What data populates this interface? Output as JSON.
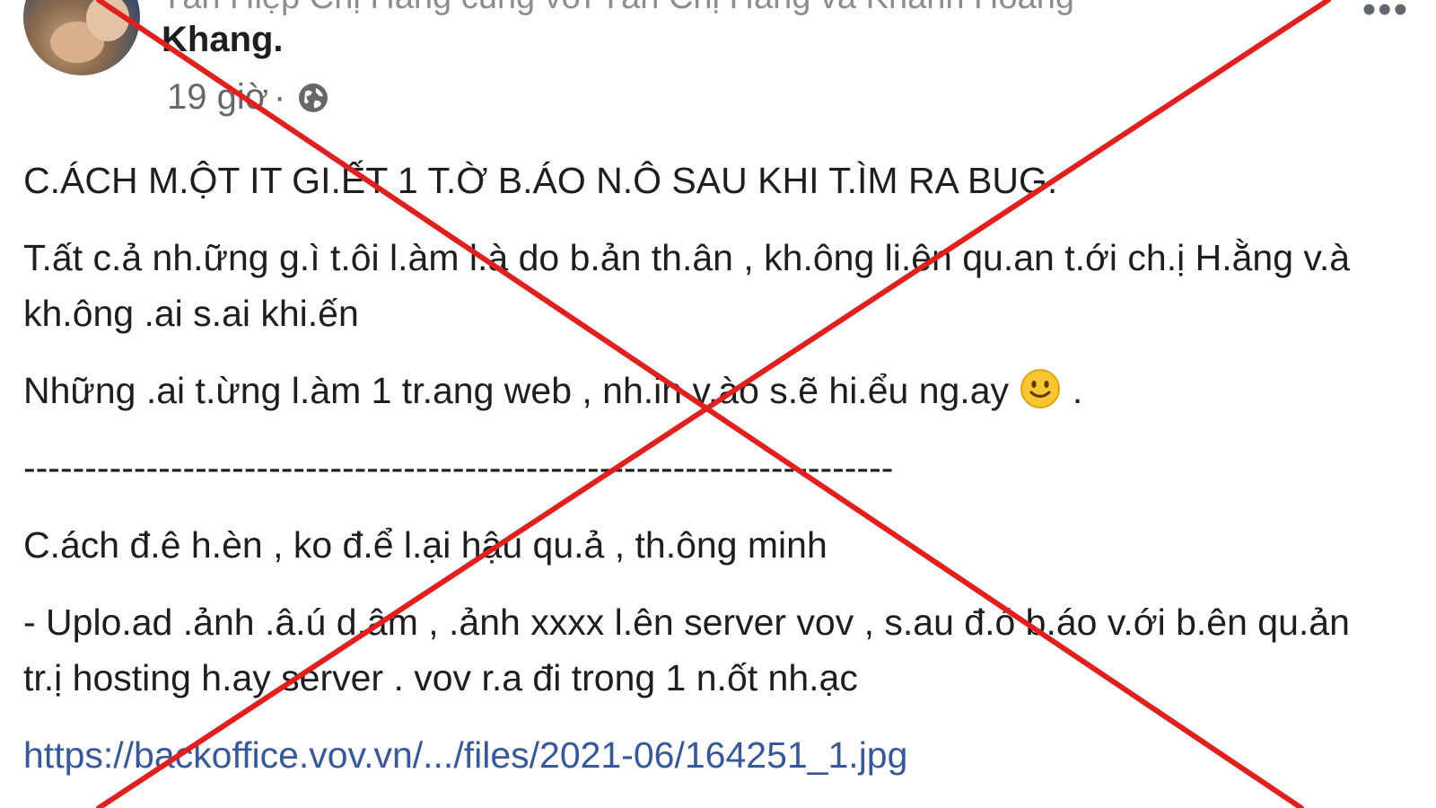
{
  "post": {
    "header_top": "Tân Hiệp Chị Hằng cùng với Tân Chị Hằng và Khánh Hoàng",
    "author": "Khang.",
    "time": "19 giờ",
    "separator": "·",
    "privacy_icon": "globe-icon",
    "more_icon": "more-options-icon",
    "more_symbol": "•••"
  },
  "content": {
    "line1": "C.ÁCH M.ỘT IT GI.ẾT 1 T.Ờ B.ÁO N.Ô SAU KHI T.ÌM RA BUG.",
    "line2": "T.ất c.ả nh.ững g.ì t.ôi l.àm l.à do b.ản th.ân , kh.ông li.ên qu.an t.ới ch.ị H.ằng v.à kh.ông .ai s.ai khi.ến",
    "line3_text": "Những .ai t.ừng l.àm 1 tr.ang web , nh.in v.ào s.ẽ hi.ểu ng.ay",
    "line3_emoji": "smile-emoji",
    "line3_end": " .",
    "divider": "-----------------------------------------------------------------------",
    "line4": "C.ách đ.ê h.èn , ko đ.ể l.ại hậu qu.ả , th.ông minh",
    "line5": "- Uplo.ad .ảnh .â.ú d.âm  , .ảnh xxxx l.ên server vov , s.au đ.ó b.áo v.ới b.ên qu.ản tr.ị hosting h.ay server . vov r.a đi trong 1   n.ốt nh.ạc",
    "link": "https://backoffice.vov.vn/.../files/2021-06/164251_1.jpg"
  },
  "overlay": {
    "mark": "red-x-cross",
    "color": "#e0201e"
  },
  "colors": {
    "link": "#385898",
    "meta": "#65676b"
  }
}
